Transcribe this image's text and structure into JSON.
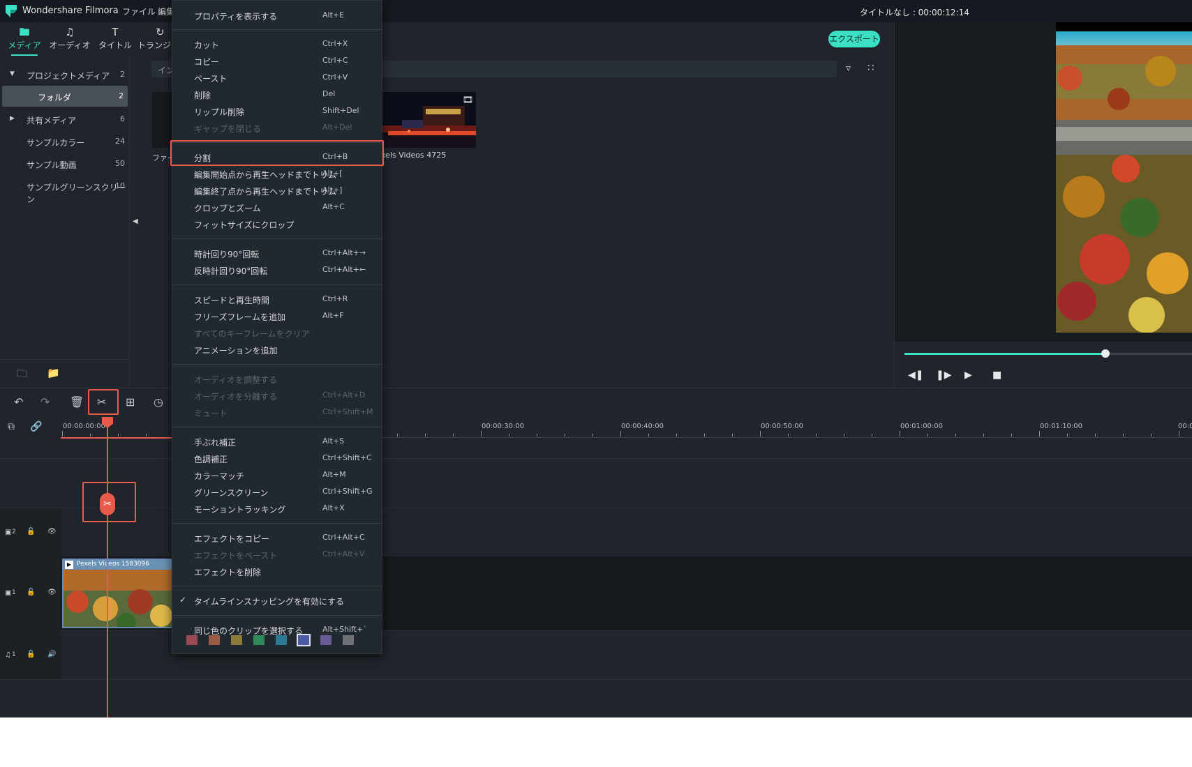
{
  "app": {
    "name": "Wondershare Filmora",
    "menu_file": "ファイル",
    "menu_edit": "編集",
    "project_title": "タイトルなし : 00:00:12:14",
    "export_label": "エクスポート"
  },
  "tabs": [
    {
      "label": "メディア",
      "icon": "folder-icon",
      "active": true
    },
    {
      "label": "オーディオ",
      "icon": "music-note-icon",
      "active": false
    },
    {
      "label": "タイトル",
      "icon": "title-t-icon",
      "active": false
    },
    {
      "label": "トランジ",
      "icon": "transition-icon",
      "active": false
    }
  ],
  "sidebar": {
    "items": [
      {
        "label": "プロジェクトメディア",
        "count": "2"
      },
      {
        "label": "フォルダ",
        "count": "2"
      },
      {
        "label": "共有メディア",
        "count": "6"
      },
      {
        "label": "サンプルカラー",
        "count": "24"
      },
      {
        "label": "サンプル動画",
        "count": "50"
      },
      {
        "label": "サンプルグリーンスクリーン",
        "count": "10"
      }
    ]
  },
  "media": {
    "search_placeholder": "イン",
    "left_thumb_label": "ファイ",
    "right_thumb_label": "xels Videos 4725"
  },
  "timeline": {
    "ruler_labels": [
      "00:00:00:00",
      "00:00:30:00",
      "00:00:40:00",
      "00:00:50:00",
      "00:01:00:00",
      "00:01:10:00",
      "00:0"
    ],
    "clip_label": "Pexels Videos 1583096",
    "track_v2": "2",
    "track_v1": "1",
    "track_a1": "1"
  },
  "context_menu": {
    "items": [
      {
        "label": "プロパティを表示する",
        "shortcut": "Alt+E",
        "disabled": false
      },
      {
        "label": "カット",
        "shortcut": "Ctrl+X",
        "disabled": false
      },
      {
        "label": "コピー",
        "shortcut": "Ctrl+C",
        "disabled": false
      },
      {
        "label": "ペースト",
        "shortcut": "Ctrl+V",
        "disabled": false
      },
      {
        "label": "削除",
        "shortcut": "Del",
        "disabled": false
      },
      {
        "label": "リップル削除",
        "shortcut": "Shift+Del",
        "disabled": false
      },
      {
        "label": "ギャップを閉じる",
        "shortcut": "Alt+Del",
        "disabled": true
      },
      {
        "label": "分割",
        "shortcut": "Ctrl+B",
        "disabled": false
      },
      {
        "label": "編集開始点から再生ヘッドまでトリム",
        "shortcut": "Alt+[",
        "disabled": false
      },
      {
        "label": "編集終了点から再生ヘッドまでトリム",
        "shortcut": "Alt+]",
        "disabled": false
      },
      {
        "label": "クロップとズーム",
        "shortcut": "Alt+C",
        "disabled": false
      },
      {
        "label": "フィットサイズにクロップ",
        "shortcut": "",
        "disabled": false
      },
      {
        "label": "時計回り90°回転",
        "shortcut": "Ctrl+Alt+→",
        "disabled": false
      },
      {
        "label": "反時計回り90°回転",
        "shortcut": "Ctrl+Alt+←",
        "disabled": false
      },
      {
        "label": "スピードと再生時間",
        "shortcut": "Ctrl+R",
        "disabled": false
      },
      {
        "label": "フリーズフレームを追加",
        "shortcut": "Alt+F",
        "disabled": false
      },
      {
        "label": "すべてのキーフレームをクリア",
        "shortcut": "",
        "disabled": true
      },
      {
        "label": "アニメーションを追加",
        "shortcut": "",
        "disabled": false
      },
      {
        "label": "オーディオを調整する",
        "shortcut": "",
        "disabled": true
      },
      {
        "label": "オーディオを分離する",
        "shortcut": "Ctrl+Alt+D",
        "disabled": true
      },
      {
        "label": "ミュート",
        "shortcut": "Ctrl+Shift+M",
        "disabled": true
      },
      {
        "label": "手ぶれ補正",
        "shortcut": "Alt+S",
        "disabled": false
      },
      {
        "label": "色調補正",
        "shortcut": "Ctrl+Shift+C",
        "disabled": false
      },
      {
        "label": "カラーマッチ",
        "shortcut": "Alt+M",
        "disabled": false
      },
      {
        "label": "グリーンスクリーン",
        "shortcut": "Ctrl+Shift+G",
        "disabled": false
      },
      {
        "label": "モーショントラッキング",
        "shortcut": "Alt+X",
        "disabled": false
      },
      {
        "label": "エフェクトをコピー",
        "shortcut": "Ctrl+Alt+C",
        "disabled": false
      },
      {
        "label": "エフェクトをペースト",
        "shortcut": "Ctrl+Alt+V",
        "disabled": true
      },
      {
        "label": "エフェクトを削除",
        "shortcut": "",
        "disabled": false
      },
      {
        "label": "タイムラインスナッピングを有効にする",
        "shortcut": "",
        "disabled": false,
        "checked": true
      },
      {
        "label": "同じ色のクリップを選択する",
        "shortcut": "Alt+Shift+`",
        "disabled": false
      }
    ],
    "color_swatches": [
      "#9a4a52",
      "#9a5a44",
      "#8e7a3a",
      "#2f8a5a",
      "#2a7a96",
      "#4a5aa6",
      "#6a5a96",
      "#6e7276"
    ],
    "selected_swatch_index": 5
  },
  "colors": {
    "accent": "#3ce0c4",
    "highlight": "#ea5a4a",
    "background": "#1f252b"
  }
}
